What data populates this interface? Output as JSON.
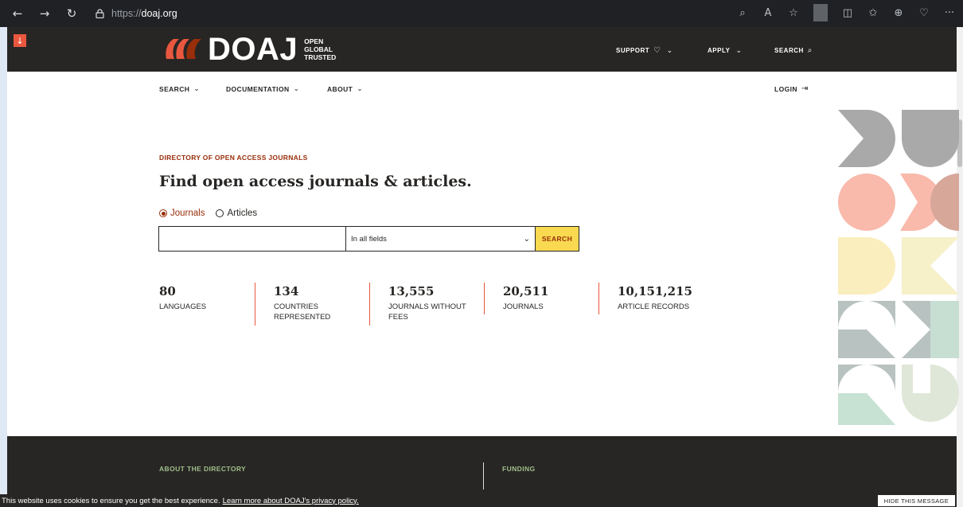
{
  "browser": {
    "url_prefix": "https://",
    "url_host": "doaj.org"
  },
  "header": {
    "logo_text": "DOAJ",
    "tagline": [
      "OPEN",
      "GLOBAL",
      "TRUSTED"
    ],
    "nav": {
      "support": "SUPPORT",
      "apply": "APPLY",
      "search": "SEARCH"
    }
  },
  "subnav": {
    "search": "SEARCH",
    "documentation": "DOCUMENTATION",
    "about": "ABOUT",
    "login": "LOGIN"
  },
  "hero": {
    "eyebrow": "DIRECTORY OF OPEN ACCESS JOURNALS",
    "headline": "Find open access journals & articles.",
    "radio_journals": "Journals",
    "radio_articles": "Articles",
    "search_value": "",
    "field_select": "In all fields",
    "search_button": "SEARCH"
  },
  "stats": [
    {
      "value": "80",
      "label": "LANGUAGES"
    },
    {
      "value": "134",
      "label": "COUNTRIES REPRESENTED"
    },
    {
      "value": "13,555",
      "label": "JOURNALS WITHOUT FEES"
    },
    {
      "value": "20,511",
      "label": "JOURNALS"
    },
    {
      "value": "10,151,215",
      "label": "ARTICLE RECORDS"
    }
  ],
  "footer": {
    "about_title": "ABOUT THE DIRECTORY",
    "funding_title": "FUNDING"
  },
  "cookie": {
    "text": "This website uses cookies to ensure you get the best experience.",
    "link": "Learn more about DOAJ's privacy policy.",
    "hide": "HIDE THIS MESSAGE"
  },
  "colors": {
    "dark": "#282624",
    "accent": "#982e0a",
    "orange": "#e9573f",
    "yellow": "#f9d950",
    "green": "#9fbf8b"
  }
}
